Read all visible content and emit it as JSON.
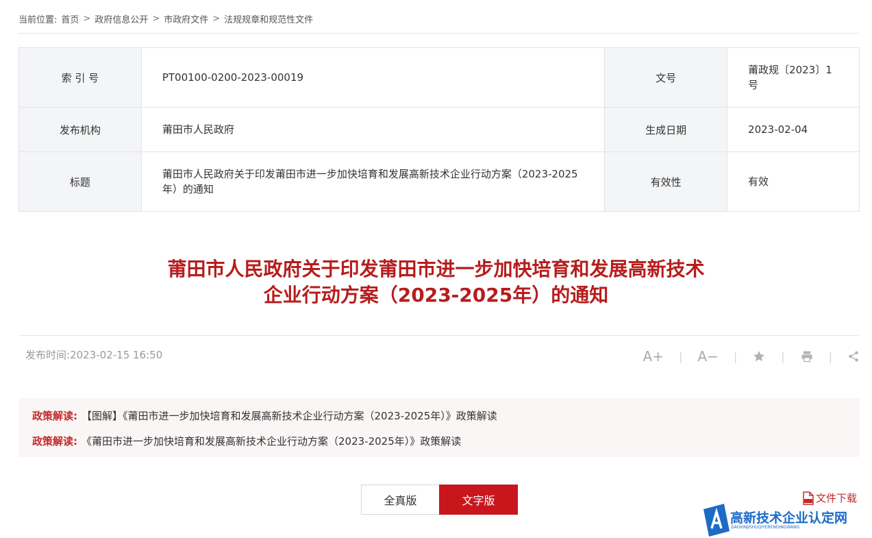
{
  "breadcrumb": {
    "prefix": "当前位置:",
    "items": [
      "首页",
      "政府信息公开",
      "市政府文件",
      "法规规章和规范性文件"
    ],
    "separator": ">"
  },
  "meta_table": {
    "index_label": "索 引 号",
    "index_value": "PT00100-0200-2023-00019",
    "docno_label": "文号",
    "docno_value": "莆政规〔2023〕1号",
    "publisher_label": "发布机构",
    "publisher_value": "莆田市人民政府",
    "date_label": "生成日期",
    "date_value": "2023-02-04",
    "title_label": "标题",
    "title_value": "莆田市人民政府关于印发莆田市进一步加快培育和发展高新技术企业行动方案（2023-2025年）的通知",
    "validity_label": "有效性",
    "validity_value": "有效"
  },
  "article": {
    "title_line1": "莆田市人民政府关于印发莆田市进一步加快培育和发展高新技术",
    "title_line2": "企业行动方案（2023-2025年）的通知",
    "publish_time_label": "发布时间:",
    "publish_time_value": "2023-02-15 16:50"
  },
  "tools": {
    "font_increase": "A+",
    "font_decrease": "A−",
    "separator": "|",
    "icons": [
      "star-icon",
      "print-icon",
      "share-icon"
    ]
  },
  "policy": {
    "label": "政策解读:",
    "items": [
      "【图解】《莆田市进一步加快培育和发展高新技术企业行动方案（2023-2025年）》政策解读",
      "《莆田市进一步加快培育和发展高新技术企业行动方案（2023-2025年）》政策解读"
    ]
  },
  "view_buttons": {
    "full_label": "全真版",
    "text_label": "文字版"
  },
  "download": {
    "label": "文件下载",
    "icon": "pdf-icon"
  },
  "watermark": {
    "title": "高新技术企业认定网",
    "subtitle": "GAOXINJISHUQIYERENDINGWANG"
  },
  "colors": {
    "accent": "#c9161d",
    "title_red": "#b71c1c",
    "label_bg": "#f4f5f7",
    "watermark_blue": "#1c6bc7"
  }
}
